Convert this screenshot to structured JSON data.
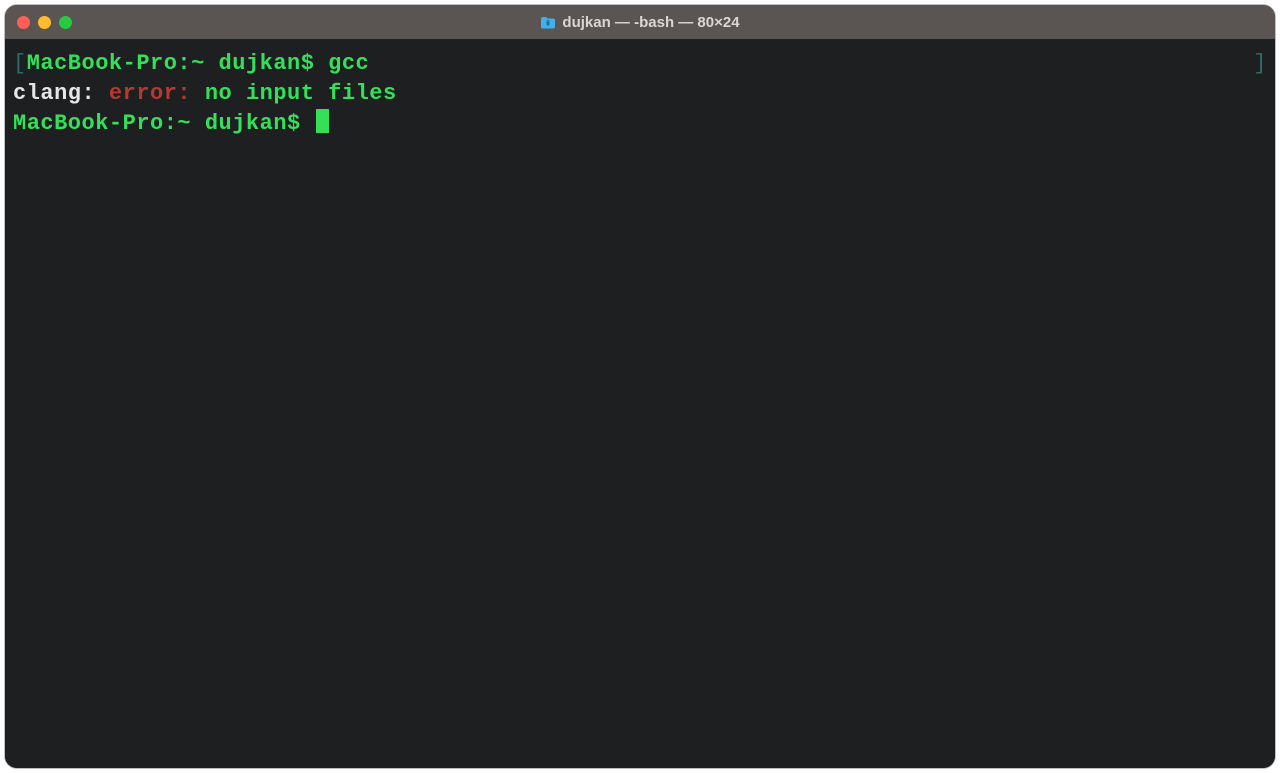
{
  "window": {
    "title": "dujkan — -bash — 80×24"
  },
  "terminal": {
    "bracket_left": "[",
    "bracket_right": "]",
    "line1": {
      "prompt": "MacBook-Pro:~ dujkan$ ",
      "command": "gcc"
    },
    "line2": {
      "prefix": "clang: ",
      "error_label": "error: ",
      "message": "no input files"
    },
    "line3": {
      "prompt": "MacBook-Pro:~ dujkan$ "
    }
  }
}
